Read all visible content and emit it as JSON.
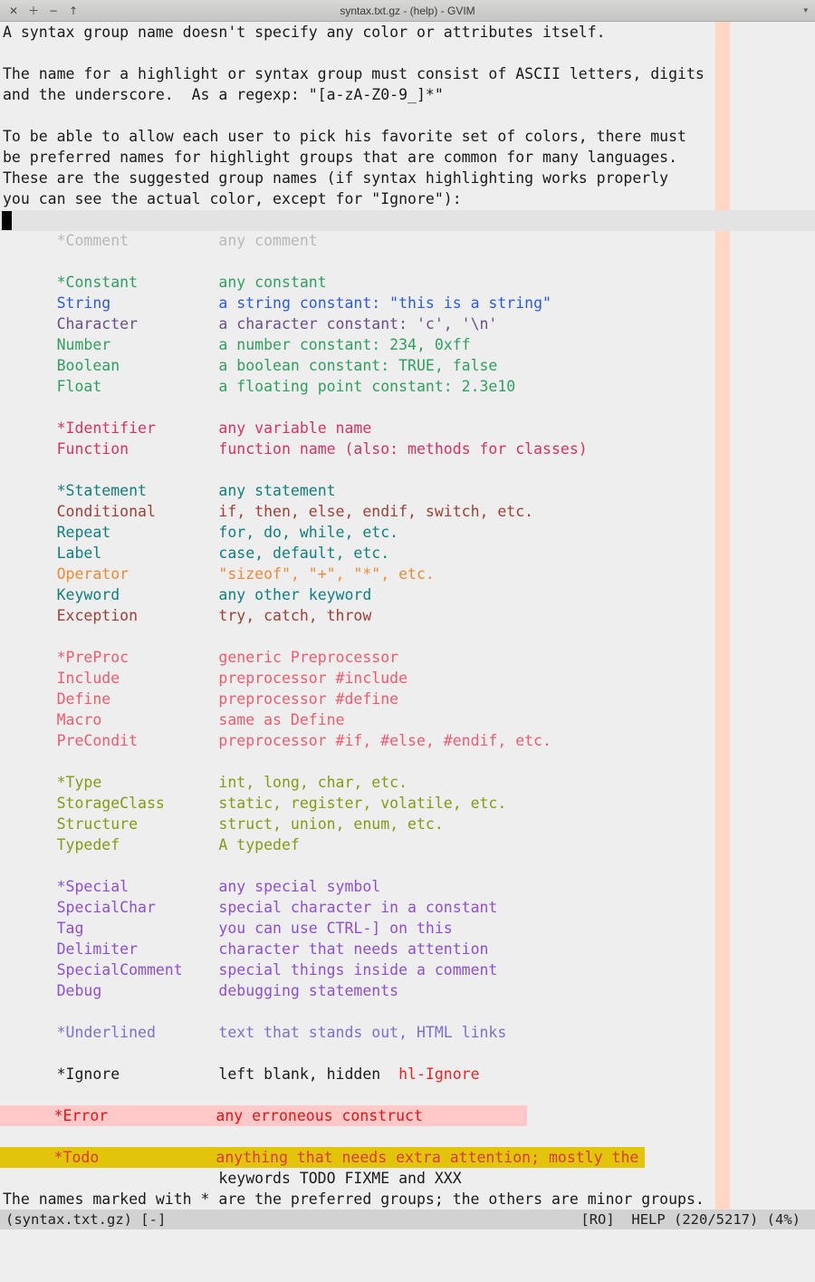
{
  "window": {
    "title": "syntax.txt.gz - (help) - GVIM",
    "titlebar_buttons": [
      {
        "name": "close-button",
        "glyph": "✕"
      },
      {
        "name": "maximize-button",
        "glyph": "＋"
      },
      {
        "name": "minimize-button",
        "glyph": "−"
      },
      {
        "name": "shade-up-button",
        "glyph": "↑"
      }
    ],
    "menu_arrow": "▾"
  },
  "colors": {
    "background": "#eeeeee",
    "foreground": "#1a1a1a",
    "cursorline": "#e3e3e3",
    "colorcolumn": "#ffd7c4",
    "statusline_bg": "#d2d2d2",
    "comment": "#b8b8b8",
    "constant": "#2fa05f",
    "string": "#2b5be2",
    "character": "#6b4f8c",
    "identifier": "#d9335f",
    "statement": "#107f7f",
    "conditional": "#9e4038",
    "operator": "#f08a35",
    "preproc": "#f15b6e",
    "type": "#849b12",
    "special": "#8e4fd6",
    "underlined": "#7b70d0",
    "ignore": "#1a1a1a",
    "error_fg": "#ee1111",
    "error_bg": "#ffc9c9",
    "todo_fg": "#d93a3a",
    "todo_bg": "#e2c40a",
    "link": "#ee2222"
  },
  "intro": {
    "paragraph1": "A syntax group name doesn't specify any color or attributes itself.",
    "paragraph2_line1": "The name for a highlight or syntax group must consist of ASCII letters, digits",
    "paragraph2_line2": "and the underscore.  As a regexp: \"[a-zA-Z0-9_]*\"",
    "paragraph3_line1": "To be able to allow each user to pick his favorite set of colors, there must",
    "paragraph3_line2": "be preferred names for highlight groups that are common for many languages.",
    "paragraph3_line3": "These are the suggested group names (if syntax highlighting works properly",
    "paragraph3_line4": "you can see the actual color, except for \"Ignore\"):"
  },
  "groups": [
    {
      "id": "comment",
      "name": "*Comment",
      "desc": "any comment",
      "color_key": "comment",
      "preferred": true
    },
    {
      "id": "spacer1",
      "name": "",
      "desc": "",
      "color_key": "foreground",
      "preferred": false
    },
    {
      "id": "constant",
      "name": "*Constant",
      "desc": "any constant",
      "color_key": "constant",
      "preferred": true
    },
    {
      "id": "string",
      "name": "String",
      "desc": "a string constant: \"this is a string\"",
      "color_key": "string",
      "preferred": false
    },
    {
      "id": "character",
      "name": "Character",
      "desc": "a character constant: 'c', '\\n'",
      "color_key": "character",
      "preferred": false
    },
    {
      "id": "number",
      "name": "Number",
      "desc": "a number constant: 234, 0xff",
      "color_key": "constant",
      "preferred": false
    },
    {
      "id": "boolean",
      "name": "Boolean",
      "desc": "a boolean constant: TRUE, false",
      "color_key": "constant",
      "preferred": false
    },
    {
      "id": "float",
      "name": "Float",
      "desc": "a floating point constant: 2.3e10",
      "color_key": "constant",
      "preferred": false
    },
    {
      "id": "spacer2",
      "name": "",
      "desc": "",
      "color_key": "foreground",
      "preferred": false
    },
    {
      "id": "identifier",
      "name": "*Identifier",
      "desc": "any variable name",
      "color_key": "identifier",
      "preferred": true
    },
    {
      "id": "function",
      "name": "Function",
      "desc": "function name (also: methods for classes)",
      "color_key": "identifier",
      "preferred": false
    },
    {
      "id": "spacer3",
      "name": "",
      "desc": "",
      "color_key": "foreground",
      "preferred": false
    },
    {
      "id": "statement",
      "name": "*Statement",
      "desc": "any statement",
      "color_key": "statement",
      "preferred": true
    },
    {
      "id": "conditional",
      "name": "Conditional",
      "desc": "if, then, else, endif, switch, etc.",
      "color_key": "conditional",
      "preferred": false
    },
    {
      "id": "repeat",
      "name": "Repeat",
      "desc": "for, do, while, etc.",
      "color_key": "statement",
      "preferred": false
    },
    {
      "id": "label",
      "name": "Label",
      "desc": "case, default, etc.",
      "color_key": "statement",
      "preferred": false
    },
    {
      "id": "operator",
      "name": "Operator",
      "desc": "\"sizeof\", \"+\", \"*\", etc.",
      "color_key": "operator",
      "preferred": false
    },
    {
      "id": "keyword",
      "name": "Keyword",
      "desc": "any other keyword",
      "color_key": "statement",
      "preferred": false
    },
    {
      "id": "exception",
      "name": "Exception",
      "desc": "try, catch, throw",
      "color_key": "conditional",
      "preferred": false
    },
    {
      "id": "spacer4",
      "name": "",
      "desc": "",
      "color_key": "foreground",
      "preferred": false
    },
    {
      "id": "preproc",
      "name": "*PreProc",
      "desc": "generic Preprocessor",
      "color_key": "preproc",
      "preferred": true
    },
    {
      "id": "include",
      "name": "Include",
      "desc": "preprocessor #include",
      "color_key": "preproc",
      "preferred": false
    },
    {
      "id": "define",
      "name": "Define",
      "desc": "preprocessor #define",
      "color_key": "preproc",
      "preferred": false
    },
    {
      "id": "macro",
      "name": "Macro",
      "desc": "same as Define",
      "color_key": "preproc",
      "preferred": false
    },
    {
      "id": "precondit",
      "name": "PreCondit",
      "desc": "preprocessor #if, #else, #endif, etc.",
      "color_key": "preproc",
      "preferred": false
    },
    {
      "id": "spacer5",
      "name": "",
      "desc": "",
      "color_key": "foreground",
      "preferred": false
    },
    {
      "id": "type",
      "name": "*Type",
      "desc": "int, long, char, etc.",
      "color_key": "type",
      "preferred": true
    },
    {
      "id": "storageclass",
      "name": "StorageClass",
      "desc": "static, register, volatile, etc.",
      "color_key": "type",
      "preferred": false
    },
    {
      "id": "structure",
      "name": "Structure",
      "desc": "struct, union, enum, etc.",
      "color_key": "type",
      "preferred": false
    },
    {
      "id": "typedef",
      "name": "Typedef",
      "desc": "A typedef",
      "color_key": "type",
      "preferred": false
    },
    {
      "id": "spacer6",
      "name": "",
      "desc": "",
      "color_key": "foreground",
      "preferred": false
    },
    {
      "id": "special",
      "name": "*Special",
      "desc": "any special symbol",
      "color_key": "special",
      "preferred": true
    },
    {
      "id": "specialchar",
      "name": "SpecialChar",
      "desc": "special character in a constant",
      "color_key": "special",
      "preferred": false
    },
    {
      "id": "tag",
      "name": "Tag",
      "desc": "you can use CTRL-] on this",
      "color_key": "special",
      "preferred": false
    },
    {
      "id": "delimiter",
      "name": "Delimiter",
      "desc": "character that needs attention",
      "color_key": "special",
      "preferred": false
    },
    {
      "id": "specialcomment",
      "name": "SpecialComment",
      "desc": "special things inside a comment",
      "color_key": "special",
      "preferred": false
    },
    {
      "id": "debug",
      "name": "Debug",
      "desc": "debugging statements",
      "color_key": "special",
      "preferred": false
    },
    {
      "id": "spacer7",
      "name": "",
      "desc": "",
      "color_key": "foreground",
      "preferred": false
    },
    {
      "id": "underlined",
      "name": "*Underlined",
      "desc": "text that stands out, HTML links",
      "color_key": "underlined",
      "preferred": true
    },
    {
      "id": "spacer8",
      "name": "",
      "desc": "",
      "color_key": "foreground",
      "preferred": false
    },
    {
      "id": "ignore",
      "name": "*Ignore",
      "desc": "left blank, hidden",
      "color_key": "ignore",
      "preferred": true,
      "link_text": "hl-Ignore"
    },
    {
      "id": "spacer9",
      "name": "",
      "desc": "",
      "color_key": "foreground",
      "preferred": false
    },
    {
      "id": "error",
      "name": "*Error",
      "desc": "any erroneous construct",
      "color_key": "error_fg",
      "preferred": true,
      "highlight_bg": "error_bg"
    },
    {
      "id": "spacer10",
      "name": "",
      "desc": "",
      "color_key": "foreground",
      "preferred": false
    },
    {
      "id": "todo",
      "name": "*Todo",
      "desc": "anything that needs extra attention; mostly the",
      "color_key": "todo_fg",
      "preferred": true,
      "highlight_bg": "todo_bg",
      "continuation": "keywords TODO FIXME and XXX"
    }
  ],
  "footer": {
    "note": "The names marked with * are the preferred groups; the others are minor groups."
  },
  "statusline": {
    "left": "(syntax.txt.gz) [-]",
    "readonly": "[RO]",
    "right": "HELP (220/5217) (4%)"
  }
}
